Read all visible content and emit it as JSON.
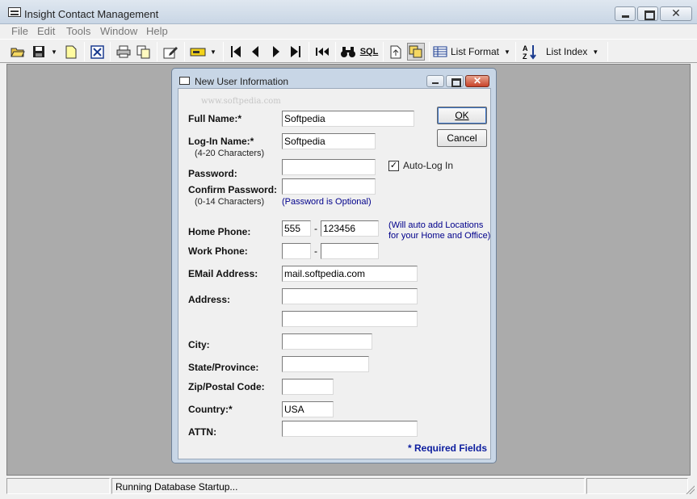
{
  "window": {
    "title": "Insight Contact Management"
  },
  "menu": [
    "File",
    "Edit",
    "Tools",
    "Window",
    "Help"
  ],
  "toolbar": {
    "sql_label": "SQL",
    "list_format_label": "List Format",
    "list_index_label": "List Index"
  },
  "dialog": {
    "title": "New User Information",
    "watermark": "www.softpedia.com",
    "ok_label": "OK",
    "cancel_label": "Cancel",
    "auto_login_label": "Auto-Log In",
    "auto_login_checked": "✓",
    "labels": {
      "full_name": "Full Name:*",
      "login_name": "Log-In Name:*",
      "login_hint": "(4-20 Characters)",
      "password": "Password:",
      "confirm_password": "Confirm Password:",
      "password_hint": "(0-14 Characters)",
      "password_optional": "(Password is Optional)",
      "home_phone": "Home Phone:",
      "work_phone": "Work Phone:",
      "phone_note_1": "(Will auto add Locations",
      "phone_note_2": "for your Home and Office)",
      "email": "EMail Address:",
      "address": "Address:",
      "city": "City:",
      "state": "State/Province:",
      "zip": "Zip/Postal Code:",
      "country": "Country:*",
      "attn": "ATTN:",
      "required": "* Required Fields",
      "dash": "-"
    },
    "values": {
      "full_name": "Softpedia",
      "login_name": "Softpedia",
      "password": "",
      "confirm_password": "",
      "home_area": "555",
      "home_number": "123456",
      "work_area": "",
      "work_number": "",
      "email": "mail.softpedia.com",
      "address1": "",
      "address2": "",
      "city": "",
      "state": "",
      "zip": "",
      "country": "USA",
      "attn": ""
    }
  },
  "status": {
    "message": "Running Database Startup..."
  }
}
